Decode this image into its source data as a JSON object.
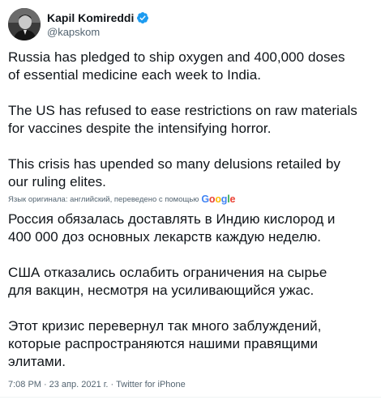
{
  "author": {
    "display_name": "Kapil Komireddi",
    "handle": "@kapskom",
    "verified_icon": "verified-badge-icon"
  },
  "tweet": {
    "paragraph_1": "Russia has pledged to ship oxygen and 400,000 doses\nof essential medicine each week to India.",
    "paragraph_2": "The US has refused to ease restrictions on raw materials\nfor vaccines despite the intensifying horror.",
    "paragraph_3": "This crisis has upended so many delusions retailed by\nour ruling elites."
  },
  "translation": {
    "label": "Язык оригинала: английский, переведено с помощью",
    "provider": "Google",
    "paragraph_1": "Россия обязалась доставлять в Индию кислород и\n400 000 доз основных лекарств каждую неделю.",
    "paragraph_2": " США отказались ослабить ограничения на сырье\nдля вакцин, несмотря на усиливающийся ужас.",
    "paragraph_3": " Этот кризис перевернул так много заблуждений,\nкоторые распространяются нашими правящими\nэлитами."
  },
  "meta": {
    "time": "7:08 PM",
    "date": "23 апр. 2021 г.",
    "client": "Twitter for iPhone",
    "separator": "·"
  },
  "colors": {
    "text": "#0f1419",
    "secondary": "#536471",
    "verified": "#1d9bf0"
  }
}
